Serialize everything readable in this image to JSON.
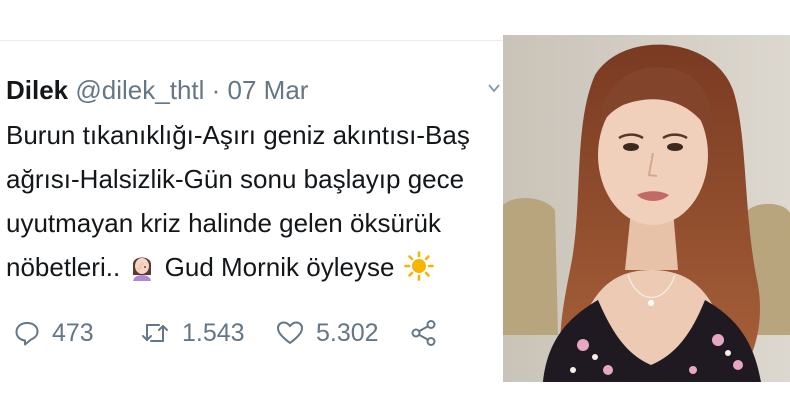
{
  "tweet": {
    "author_name": "Dilek",
    "author_handle": "@dilek_thtl",
    "separator": " · ",
    "date": "07 Mar",
    "text_lines": [
      "Burun tıkanıklığı-Aşırı geniz akıntısı-Baş",
      "ağrısı-Halsizlik-Gün sonu başlayıp gece",
      "uyutmayan kriz halinde gelen öksürük",
      "nöbetleri..",
      "Gud Mornik öyleyse"
    ],
    "emojis": [
      "facepalm-woman-emoji",
      "sun-emoji"
    ],
    "stats": {
      "replies": "473",
      "retweets": "1.543",
      "likes": "5.302"
    },
    "icons": [
      "caret-down-icon",
      "reply-icon",
      "retweet-icon",
      "like-icon",
      "share-icon"
    ]
  },
  "photo": {
    "subject": "portrait-photo"
  },
  "colors": {
    "text": "#14171a",
    "muted": "#657786",
    "divider": "#e6ecf0"
  }
}
